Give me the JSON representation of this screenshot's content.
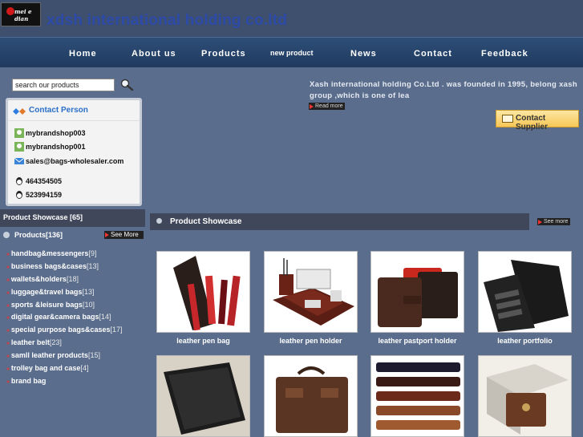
{
  "logo": {
    "text": "mei e dian"
  },
  "site_title": "xdsh  international holding co.ltd",
  "nav": [
    "Home",
    "About us",
    "Products",
    "new product",
    "News",
    "Contact",
    "Feedback"
  ],
  "search": {
    "placeholder": "search our products"
  },
  "contact": {
    "title": "Contact Person",
    "persons": [
      "mybrandshop003",
      "mybrandshop001"
    ],
    "email": "sales@bags-wholesaler.com",
    "qq": [
      "464354505",
      "523994159"
    ]
  },
  "intro": {
    "text": "Xash international holding  Co.Ltd . was founded in 1995, belong  xash group ,which is one of lea",
    "read_more": "Read more"
  },
  "contact_supplier": "Contact Supplier",
  "left_showcase": "Product Showcase [65]",
  "products_row": {
    "label": "Products[136]",
    "see_more": "See More"
  },
  "categories": [
    {
      "name": "handbag&messengers",
      "count": "[9]"
    },
    {
      "name": "business bags&cases",
      "count": "[13]"
    },
    {
      "name": "wallets&holders",
      "count": "[18]"
    },
    {
      "name": "luggage&travel bags",
      "count": "[13]"
    },
    {
      "name": "sports &leisure bags",
      "count": "[10]"
    },
    {
      "name": "digital gear&camera bags",
      "count": "[14]"
    },
    {
      "name": "special purpose bags&cases",
      "count": "[17]"
    },
    {
      "name": "leather belt",
      "count": "[23]"
    },
    {
      "name": "samll leather products",
      "count": "[15]"
    },
    {
      "name": "trolley bag and case",
      "count": "[4]"
    },
    {
      "name": "brand bag",
      "count": ""
    }
  ],
  "main_showcase": {
    "label": "Product Showcase",
    "see_more": "See more"
  },
  "products": [
    {
      "caption": "leather pen bag"
    },
    {
      "caption": "leather pen  holder"
    },
    {
      "caption": "leather pastport holder"
    },
    {
      "caption": "leather portfolio"
    },
    {
      "caption": ""
    },
    {
      "caption": ""
    },
    {
      "caption": ""
    },
    {
      "caption": ""
    }
  ]
}
